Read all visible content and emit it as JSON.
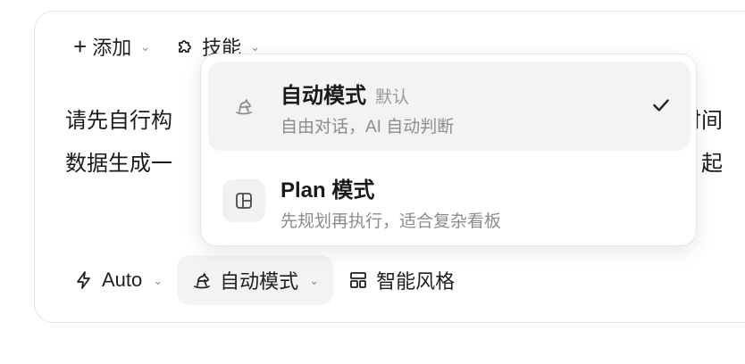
{
  "toolbar_top": {
    "add_label": "添加",
    "skills_label": "技能"
  },
  "prompt": {
    "line1_start": "请先自行构",
    "line1_end": "合时间",
    "line2_start": "数据生成一",
    "line2_end": "际、起"
  },
  "mode_menu": {
    "options": [
      {
        "title": "自动模式",
        "badge": "默认",
        "description": "自由对话，AI 自动判断",
        "selected": true,
        "icon": "rocking-horse-icon"
      },
      {
        "title": "Plan 模式",
        "badge": "",
        "description": "先规划再执行，适合复杂看板",
        "selected": false,
        "icon": "layout-panel-icon"
      }
    ]
  },
  "bottom_bar": {
    "model_label": "Auto",
    "mode_label": "自动模式",
    "style_label": "智能风格"
  },
  "colors": {
    "accent_bg": "#f3f3f3",
    "muted_text": "#8c8c8c",
    "border": "#e3e3e3"
  }
}
